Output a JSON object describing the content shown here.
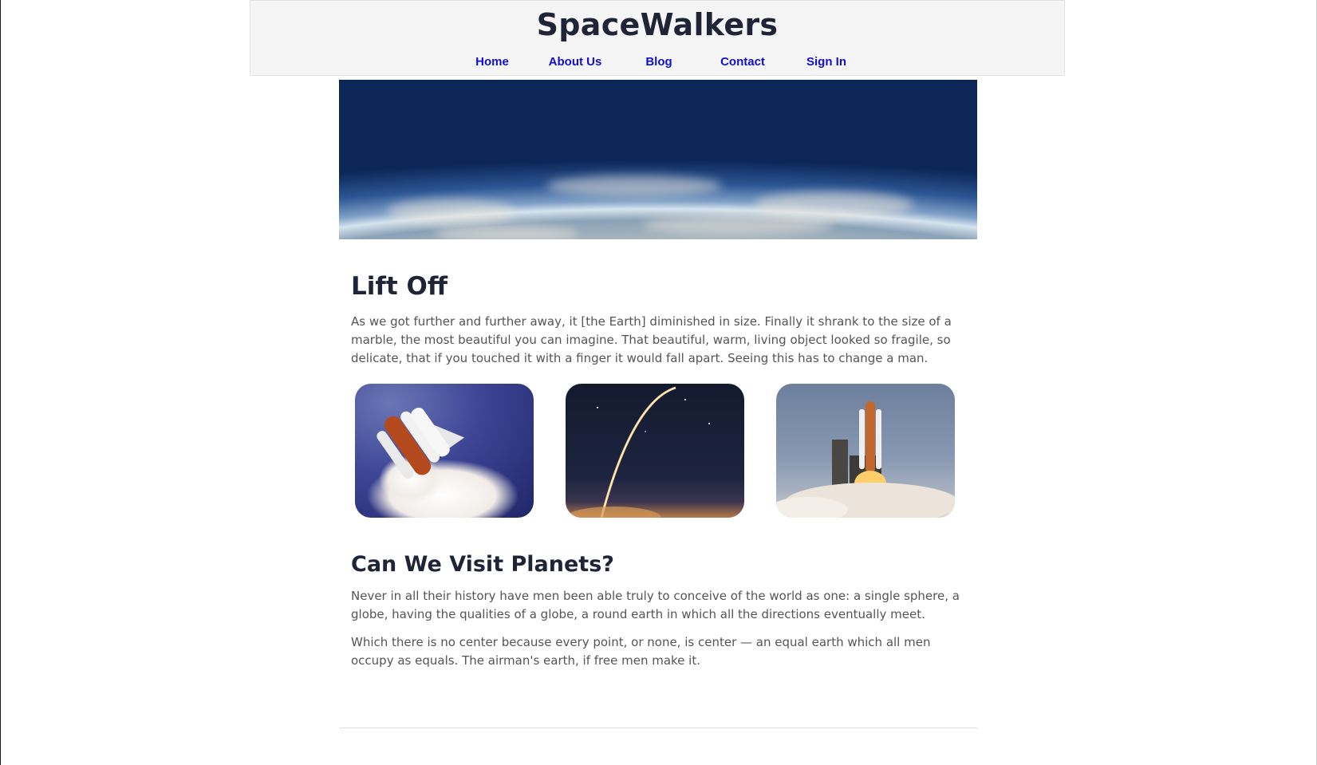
{
  "site": {
    "title": "SpaceWalkers"
  },
  "nav": {
    "items": [
      {
        "label": "Home"
      },
      {
        "label": "About Us"
      },
      {
        "label": "Blog"
      },
      {
        "label": "Contact"
      },
      {
        "label": "Sign In"
      }
    ]
  },
  "sections": [
    {
      "heading": "Lift Off",
      "paragraphs": [
        "As we got further and further away, it [the Earth] diminished in size. Finally it shrank to the size of a marble, the most beautiful you can imagine. That beautiful, warm, living object looked so fragile, so delicate, that if you touched it with a finger it would fall apart. Seeing this has to change a man."
      ]
    },
    {
      "heading": "Can We Visit Planets?",
      "paragraphs": [
        "Never in all their history have men been able truly to conceive of the world as one: a single sphere, a globe, having the qualities of a globe, a round earth in which all the directions eventually meet.",
        "Which there is no center because every point, or none, is center — an equal earth which all men occupy as equals. The airman's earth, if free men make it."
      ]
    }
  ],
  "images": {
    "hero": "earth-horizon-from-space",
    "gallery": [
      "space-shuttle-in-flight",
      "rocket-launch-trail-at-night",
      "shuttle-liftoff-from-launch-pad"
    ]
  },
  "colors": {
    "title": "#1f2437",
    "nav_link": "#1010cc",
    "header_bg": "#f5f5f5",
    "body_text": "#555555"
  }
}
